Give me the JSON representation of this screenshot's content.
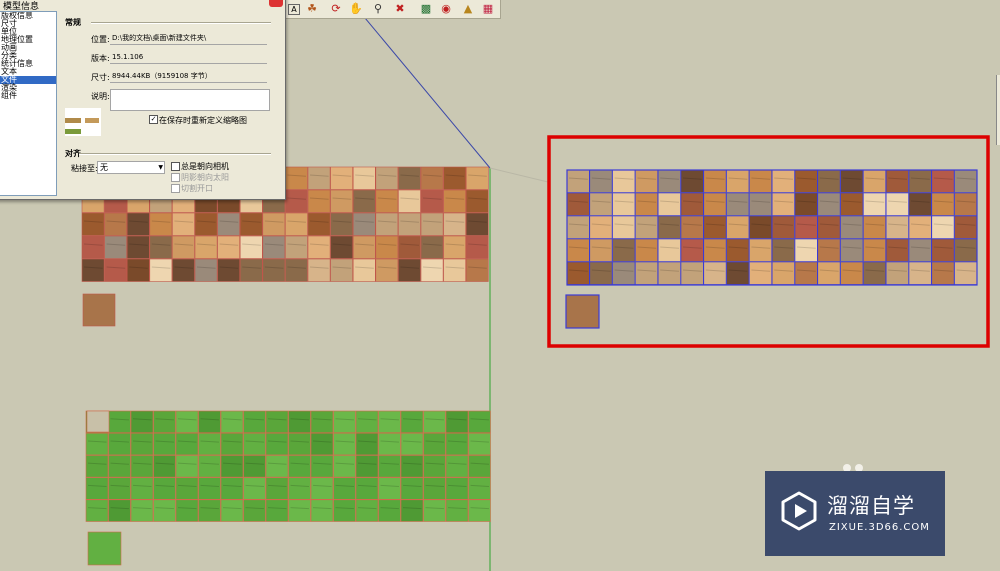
{
  "dialog": {
    "title": "模型信息",
    "categories": [
      {
        "label": "版权信息",
        "selected": false
      },
      {
        "label": "尺寸",
        "selected": false
      },
      {
        "label": "单位",
        "selected": false
      },
      {
        "label": "地理位置",
        "selected": false
      },
      {
        "label": "动画",
        "selected": false
      },
      {
        "label": "分类",
        "selected": false
      },
      {
        "label": "统计信息",
        "selected": false
      },
      {
        "label": "文本",
        "selected": false
      },
      {
        "label": "文件",
        "selected": true
      },
      {
        "label": "渲染",
        "selected": false
      },
      {
        "label": "组件",
        "selected": false
      }
    ],
    "general": {
      "heading": "常规",
      "location_label": "位置:",
      "location_value": "D:\\我的文档\\桌面\\新建文件夹\\",
      "version_label": "版本:",
      "version_value": "15.1.106",
      "size_label": "尺寸:",
      "size_value": "8944.44KB（9159108 字节）",
      "description_label": "说明:",
      "description_value": "",
      "redefine_thumbnail_label": "在保存时重新定义缩略图",
      "redefine_thumbnail_checked": true
    },
    "alignment": {
      "heading": "对齐",
      "glue_to_label": "粘接至:",
      "glue_to_value": "无",
      "always_face_camera_label": "总是朝向相机",
      "shadows_face_sun_label": "阴影朝向太阳",
      "cut_opening_label": "切割开口"
    }
  },
  "toolbar": {
    "icons": [
      "text-3d-icon",
      "paint-bucket-icon",
      "orbit-icon",
      "pan-icon",
      "zoom-icon",
      "zoom-extents-icon",
      "components-icon",
      "materials-icon",
      "warehouse-icon",
      "extension-icon"
    ]
  },
  "canvas": {
    "left_texture_grid": {
      "columns": 18,
      "rows": 5
    },
    "grass_grid": {
      "columns": 18,
      "rows": 5
    },
    "selected_texture_grid": {
      "columns": 18,
      "rows": 5
    },
    "highlight_color": "#dd0000",
    "selection_color": "#3b3bd6",
    "axis_green": "#2fa52f",
    "axis_blue": "#3b48a8"
  },
  "watermark": {
    "title": "溜溜自学",
    "url": "ZIXUE.3D66.COM"
  }
}
